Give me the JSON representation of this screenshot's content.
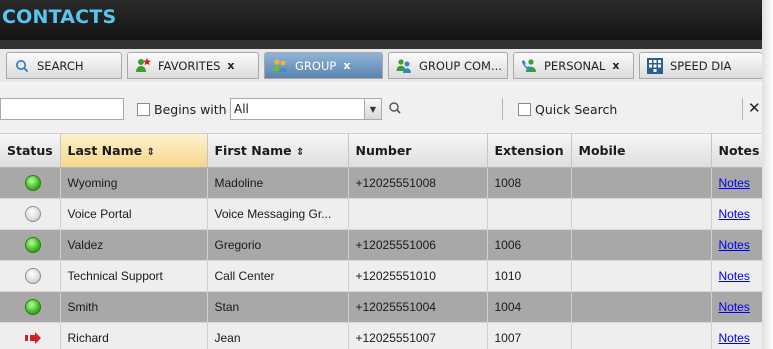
{
  "app": {
    "title": "CONTACTS"
  },
  "tabs": [
    {
      "label": "SEARCH",
      "icon": "search-icon",
      "closable": false,
      "active": false
    },
    {
      "label": "FAVORITES",
      "icon": "favorites-person-icon",
      "closable": true,
      "close_label": "x",
      "active": false
    },
    {
      "label": "GROUP",
      "icon": "group-people-icon",
      "closable": true,
      "close_label": "x",
      "active": true
    },
    {
      "label": "GROUP COM...",
      "icon": "group-common-icon",
      "closable": true,
      "close_label": "x",
      "active": false
    },
    {
      "label": "PERSONAL",
      "icon": "personal-phone-icon",
      "closable": true,
      "close_label": "x",
      "active": false
    },
    {
      "label": "SPEED DIA",
      "icon": "speed-dial-icon",
      "closable": false,
      "active": false
    }
  ],
  "toolbar": {
    "search_value": "",
    "begins_with_label": "Begins with",
    "filter_value": "All",
    "quick_search_label": "Quick Search",
    "close_glyph": "✕"
  },
  "table": {
    "columns": [
      "Status",
      "Last Name",
      "First Name",
      "Number",
      "Extension",
      "Mobile",
      "Notes"
    ],
    "sort_glyph": "⇕",
    "rows": [
      {
        "status": "online",
        "last": "Wyoming",
        "first": "Madoline",
        "number": "+12025551008",
        "ext": "1008",
        "mobile": "",
        "notes": "Notes"
      },
      {
        "status": "offline",
        "last": "Voice Portal",
        "first": "Voice Messaging Gr...",
        "number": "",
        "ext": "",
        "mobile": "",
        "notes": "Notes"
      },
      {
        "status": "online",
        "last": "Valdez",
        "first": "Gregorio",
        "number": "+12025551006",
        "ext": "1006",
        "mobile": "",
        "notes": "Notes"
      },
      {
        "status": "offline",
        "last": "Technical Support",
        "first": "Call Center",
        "number": "+12025551010",
        "ext": "1010",
        "mobile": "",
        "notes": "Notes"
      },
      {
        "status": "online",
        "last": "Smith",
        "first": "Stan",
        "number": "+12025551004",
        "ext": "1004",
        "mobile": "",
        "notes": "Notes"
      },
      {
        "status": "busy",
        "last": "Richard",
        "first": "Jean",
        "number": "+12025551007",
        "ext": "1007",
        "mobile": "",
        "notes": "Notes"
      }
    ]
  },
  "colors": {
    "title": "#58c6f0",
    "active_tab": "#6f96c0",
    "row_dark": "#a8a8a8",
    "row_light": "#eeeeee",
    "sorted_header": "#f6d68b",
    "online": "#3cb81f",
    "busy": "#cc2222"
  }
}
